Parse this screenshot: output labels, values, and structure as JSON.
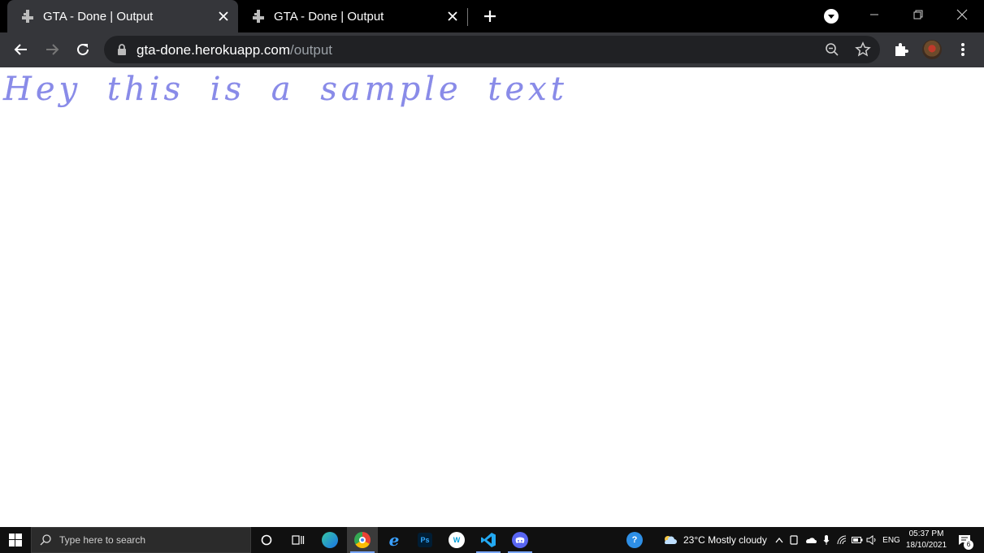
{
  "browser": {
    "tabs": [
      {
        "title": "GTA - Done | Output",
        "active": true,
        "icon": "gta-favicon"
      },
      {
        "title": "GTA - Done | Output",
        "active": false,
        "icon": "gta-favicon"
      }
    ],
    "address": {
      "domain": "gta-done.herokuapp.com",
      "path": "/output"
    }
  },
  "page": {
    "output_text": "Hey this is a sample text",
    "text_color": "#7d7fe6"
  },
  "taskbar": {
    "search_placeholder": "Type here to search",
    "weather": "23°C  Mostly cloudy",
    "language": "ENG",
    "time": "05:37 PM",
    "date": "18/10/2021",
    "notification_count": "6",
    "apps": [
      "edge-icon",
      "chrome-icon",
      "ie-icon",
      "photoshop-icon",
      "cisco-icon",
      "vscode-icon",
      "discord-icon"
    ]
  },
  "colors": {
    "chrome_dark": "#35363a",
    "omnibox": "#202124",
    "taskbar": "#101010"
  }
}
